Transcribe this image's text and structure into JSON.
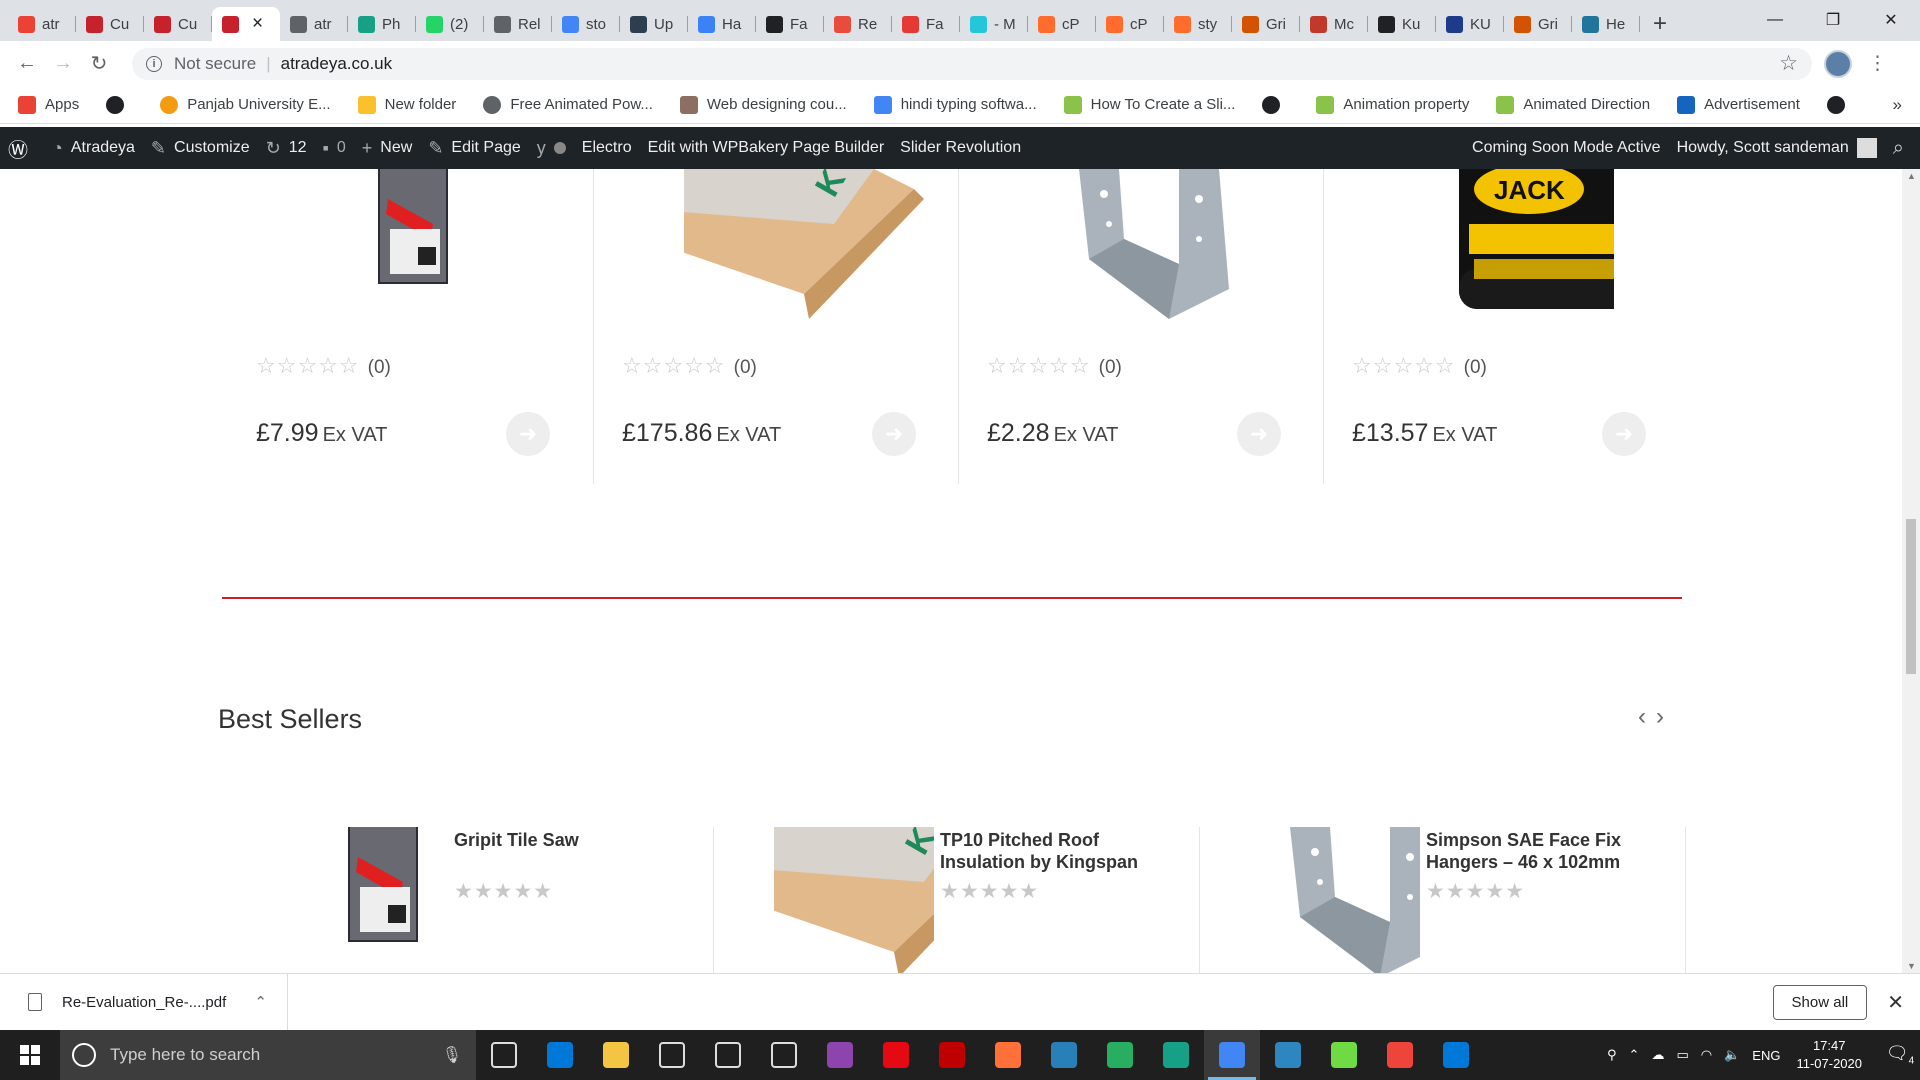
{
  "tabs": [
    {
      "title": "atr",
      "color": "#ea4335"
    },
    {
      "title": "Cu",
      "color": "#c5222d"
    },
    {
      "title": "Cu",
      "color": "#c5222d"
    },
    {
      "title": "",
      "color": "#c5222d",
      "active": true
    },
    {
      "title": "atr",
      "color": "#5f6368"
    },
    {
      "title": "Ph",
      "color": "#16a085"
    },
    {
      "title": "(2)",
      "color": "#25d366"
    },
    {
      "title": "Rel",
      "color": "#5f6368"
    },
    {
      "title": "sto",
      "color": "#4285f4"
    },
    {
      "title": "Up",
      "color": "#2c3e50"
    },
    {
      "title": "Ha",
      "color": "#3b82f6"
    },
    {
      "title": "Fa",
      "color": "#202124"
    },
    {
      "title": "Re",
      "color": "#e74c3c"
    },
    {
      "title": "Fa",
      "color": "#e53935"
    },
    {
      "title": "- M",
      "color": "#26c6da"
    },
    {
      "title": "cP",
      "color": "#ff6c2c"
    },
    {
      "title": "cP",
      "color": "#ff6c2c"
    },
    {
      "title": "sty",
      "color": "#ff6c2c"
    },
    {
      "title": "Gri",
      "color": "#d35400"
    },
    {
      "title": "Mc",
      "color": "#c0392b"
    },
    {
      "title": "Ku",
      "color": "#202124"
    },
    {
      "title": "KU",
      "color": "#1e3a8a"
    },
    {
      "title": "Gri",
      "color": "#d35400"
    },
    {
      "title": "He",
      "color": "#21759b"
    }
  ],
  "toolbar": {
    "not_secure": "Not secure",
    "url": "atradeya.co.uk"
  },
  "bookmarks": [
    {
      "label": "Apps",
      "color": "#ea4335"
    },
    {
      "label": "",
      "color": "#202124",
      "round": true
    },
    {
      "label": "Panjab University E...",
      "color": "#f39c12",
      "round": true
    },
    {
      "label": "New folder",
      "color": "#fbc02d"
    },
    {
      "label": "Free Animated Pow...",
      "color": "#5f6368",
      "round": true
    },
    {
      "label": "Web designing cou...",
      "color": "#8d6e63"
    },
    {
      "label": "hindi typing softwa...",
      "color": "#4285f4"
    },
    {
      "label": "How To Create a Sli...",
      "color": "#8bc34a"
    },
    {
      "label": "",
      "color": "#202124",
      "round": true
    },
    {
      "label": "Animation property",
      "color": "#8bc34a"
    },
    {
      "label": "Animated Direction",
      "color": "#8bc34a"
    },
    {
      "label": "Advertisement",
      "color": "#1565c0"
    },
    {
      "label": "",
      "color": "#202124",
      "round": true
    }
  ],
  "wpbar": {
    "site": "Atradeya",
    "customize": "Customize",
    "updates": "12",
    "comments": "0",
    "new": "New",
    "edit_page": "Edit Page",
    "theme": "Electro",
    "wpbakery": "Edit with WPBakery Page Builder",
    "slider": "Slider Revolution",
    "coming_soon": "Coming Soon Mode Active",
    "howdy": "Howdy, Scott sandeman"
  },
  "products": [
    {
      "rating_count": "(0)",
      "price": "£7.99",
      "vat": "Ex VAT",
      "img": "tilesaw"
    },
    {
      "rating_count": "(0)",
      "price": "£175.86",
      "vat": "Ex VAT",
      "img": "insulation"
    },
    {
      "rating_count": "(0)",
      "price": "£2.28",
      "vat": "Ex VAT",
      "img": "hanger"
    },
    {
      "rating_count": "(0)",
      "price": "£13.57",
      "vat": "Ex VAT",
      "img": "tin"
    }
  ],
  "best_sellers": {
    "heading": "Best Sellers",
    "items": [
      {
        "name": "Gripit Tile Saw"
      },
      {
        "name": "TP10 Pitched Roof Insulation by Kingspan"
      },
      {
        "name": "Simpson SAE Face Fix Hangers – 46 x 102mm"
      }
    ]
  },
  "download": {
    "filename": "Re-Evaluation_Re-....pdf",
    "show_all": "Show all"
  },
  "taskbar": {
    "search_placeholder": "Type here to search",
    "lang": "ENG",
    "time": "17:47",
    "date": "11-07-2020",
    "notif_count": "4",
    "apps": [
      {
        "name": "task-view",
        "color": "#1f1f1f"
      },
      {
        "name": "edge",
        "color": "#0078d7"
      },
      {
        "name": "file-explorer",
        "color": "#f4c542"
      },
      {
        "name": "dropbox",
        "color": "#1f1f1f"
      },
      {
        "name": "mail",
        "color": "#1f1f1f"
      },
      {
        "name": "store",
        "color": "#1f1f1f"
      },
      {
        "name": "winrar",
        "color": "#8e44ad"
      },
      {
        "name": "netflix",
        "color": "#e50914"
      },
      {
        "name": "filezilla",
        "color": "#bf0000"
      },
      {
        "name": "firefox",
        "color": "#ff7139"
      },
      {
        "name": "app",
        "color": "#2980b9"
      },
      {
        "name": "app2",
        "color": "#27ae60"
      },
      {
        "name": "app3",
        "color": "#16a085"
      },
      {
        "name": "chrome",
        "color": "#4285f4",
        "active": true
      },
      {
        "name": "app4",
        "color": "#2e86c1"
      },
      {
        "name": "upwork",
        "color": "#6fda44"
      },
      {
        "name": "anydesk",
        "color": "#ef443b"
      },
      {
        "name": "help",
        "color": "#0078d7"
      }
    ]
  }
}
